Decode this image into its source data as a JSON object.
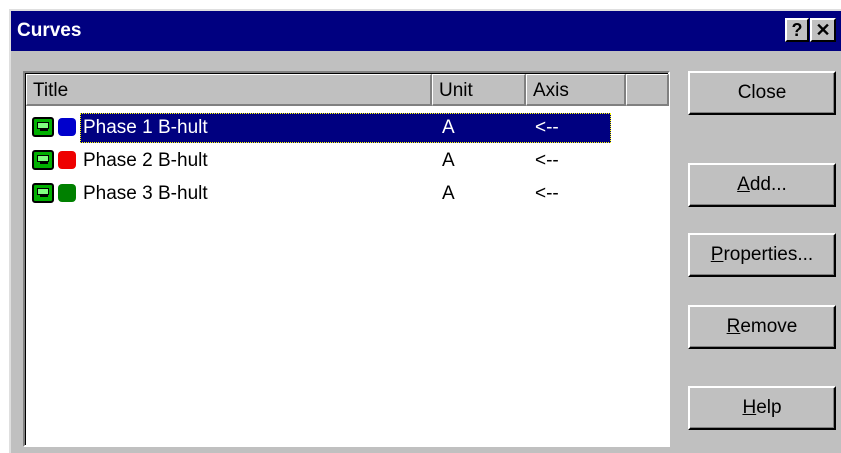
{
  "window": {
    "title": "Curves",
    "help_glyph": "?",
    "close_glyph": "✕"
  },
  "list": {
    "columns": {
      "title": "Title",
      "unit": "Unit",
      "axis": "Axis"
    },
    "rows": [
      {
        "title": "Phase 1 B-hult",
        "unit": "A",
        "axis": "<--",
        "color": "#0000cc",
        "selected": true
      },
      {
        "title": "Phase 2 B-hult",
        "unit": "A",
        "axis": "<--",
        "color": "#ee0000",
        "selected": false
      },
      {
        "title": "Phase 3 B-hult",
        "unit": "A",
        "axis": "<--",
        "color": "#008000",
        "selected": false
      }
    ]
  },
  "buttons": {
    "close": {
      "label": "Close"
    },
    "add": {
      "accel": "A",
      "rest": "dd..."
    },
    "properties": {
      "accel": "P",
      "rest": "roperties..."
    },
    "remove": {
      "accel": "R",
      "rest": "emove"
    },
    "help": {
      "accel": "H",
      "rest": "elp"
    }
  },
  "icons": {
    "row_icon": "curve-icon",
    "color_swatch": "color-swatch-icon"
  }
}
